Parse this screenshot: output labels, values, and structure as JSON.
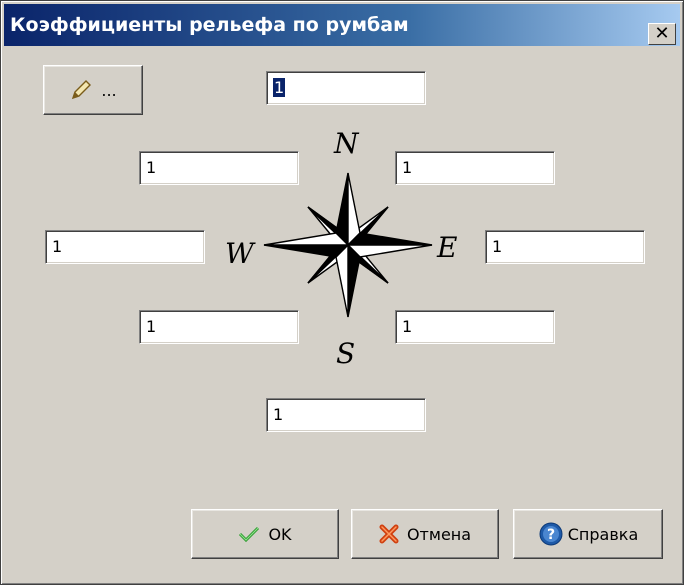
{
  "window": {
    "title": "Коэффициенты рельефа по румбам",
    "close": "✕"
  },
  "edit_button": {
    "label": "...",
    "icon": "pencil-icon"
  },
  "fields": {
    "n": "1",
    "ne": "1",
    "e": "1",
    "se": "1",
    "s": "1",
    "sw": "1",
    "w": "1",
    "nw": "1"
  },
  "compass": {
    "n": "N",
    "s": "S",
    "e": "E",
    "w": "W",
    "icon": "compass-rose-icon"
  },
  "buttons": {
    "ok": {
      "label": "OK",
      "icon": "checkmark-icon",
      "color": "#2e9b2e"
    },
    "cancel": {
      "label": "Отмена",
      "icon": "cross-icon",
      "color": "#d04010"
    },
    "help": {
      "label": "Справка",
      "icon": "help-icon",
      "color": "#1e5aa8"
    }
  }
}
